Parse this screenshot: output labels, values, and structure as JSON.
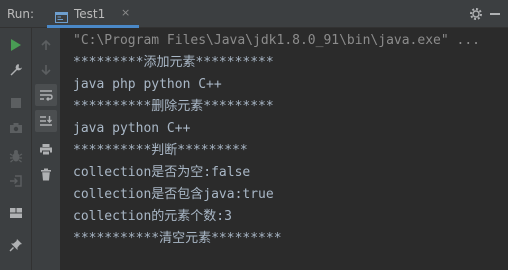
{
  "run_panel": {
    "label": "Run:",
    "tab": {
      "label": "Test1",
      "close_glyph": "×"
    }
  },
  "console": {
    "command": "\"C:\\Program Files\\Java\\jdk1.8.0_91\\bin\\java.exe\" ...",
    "lines": [
      "*********添加元素**********",
      "java php python C++",
      "**********删除元素*********",
      "java python C++",
      "**********判断*********",
      "collection是否为空:false",
      "collection是否包含java:true",
      "collection的元素个数:3",
      "***********清空元素*********"
    ]
  },
  "colors": {
    "background": "#2b2b2b",
    "toolbar": "#3c3f41",
    "text": "#a9b7c6",
    "command_text": "#8c8c8c",
    "run_green": "#499c54",
    "tab_underline": "#4a88c7"
  },
  "icons": {
    "left_toolbar": [
      "run-icon",
      "wrench-icon",
      "stop-icon",
      "camera-icon",
      "bug-icon",
      "login-icon",
      "layout-icon",
      "pin-icon"
    ],
    "right_toolbar": [
      "arrow-up-icon",
      "arrow-down-icon",
      "soft-wrap-icon",
      "scroll-to-end-icon",
      "print-icon",
      "trash-icon"
    ]
  }
}
